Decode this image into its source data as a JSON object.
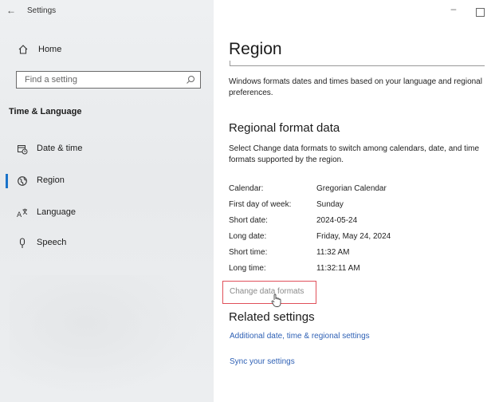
{
  "window": {
    "title": "Settings",
    "back_glyph": "←",
    "minimize_glyph": "–"
  },
  "sidebar": {
    "home_label": "Home",
    "search_placeholder": "Find a setting",
    "section_title": "Time & Language",
    "items": [
      {
        "label": "Date & time",
        "icon": "calendar-clock-icon"
      },
      {
        "label": "Region",
        "icon": "globe-icon",
        "active": true
      },
      {
        "label": "Language",
        "icon": "language-icon"
      },
      {
        "label": "Speech",
        "icon": "microphone-icon"
      }
    ]
  },
  "main": {
    "title": "Region",
    "intro": "Windows formats dates and times based on your language and regional preferences.",
    "regional_heading": "Regional format data",
    "regional_desc": "Select Change data formats to switch among calendars, date, and time formats supported by the region.",
    "formats": [
      {
        "label": "Calendar:",
        "value": "Gregorian Calendar"
      },
      {
        "label": "First day of week:",
        "value": "Sunday"
      },
      {
        "label": "Short date:",
        "value": "2024-05-24"
      },
      {
        "label": "Long date:",
        "value": "Friday, May 24, 2024"
      },
      {
        "label": "Short time:",
        "value": "11:32 AM"
      },
      {
        "label": "Long time:",
        "value": "11:32:11 AM"
      }
    ],
    "change_link": "Change data formats",
    "related_heading": "Related settings",
    "related_links": [
      "Additional date, time & regional settings",
      "Sync your settings"
    ]
  },
  "colors": {
    "accent": "#1a73c9",
    "link": "#2f61b5",
    "highlight_box": "#e0505a"
  }
}
